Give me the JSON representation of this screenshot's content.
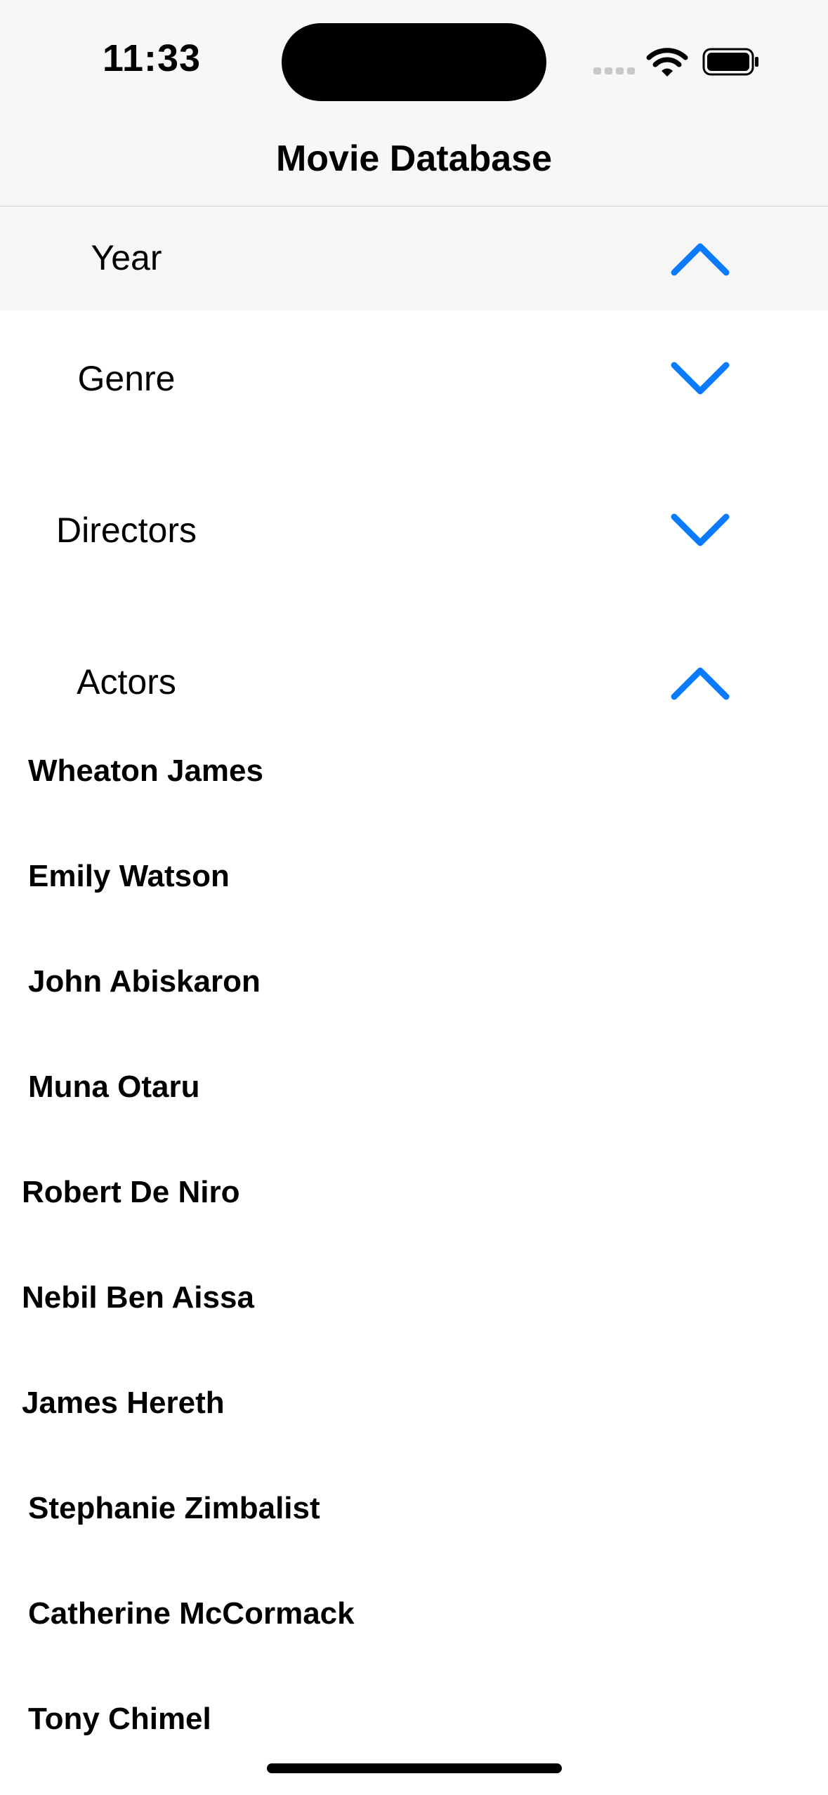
{
  "status_bar": {
    "time": "11:33",
    "icons": [
      "cellular-signal-icon",
      "wifi-icon",
      "battery-icon"
    ]
  },
  "nav": {
    "title": "Movie Database"
  },
  "sections": [
    {
      "label": "Year",
      "expanded": true,
      "chevron": "chevron-up-icon"
    },
    {
      "label": "Genre",
      "expanded": false,
      "chevron": "chevron-down-icon"
    },
    {
      "label": "Directors",
      "expanded": false,
      "chevron": "chevron-down-icon"
    },
    {
      "label": "Actors",
      "expanded": true,
      "chevron": "chevron-up-icon"
    }
  ],
  "actors": [
    "Wheaton James",
    "Emily Watson",
    "John Abiskaron",
    "Muna Otaru",
    "Robert De Niro",
    "Nebil Ben Aissa",
    "James Hereth",
    "Stephanie Zimbalist",
    "Catherine McCormack",
    "Tony Chimel"
  ],
  "colors": {
    "accent": "#0a7bff",
    "text": "#000000",
    "header_bg": "#f7f7f7"
  }
}
